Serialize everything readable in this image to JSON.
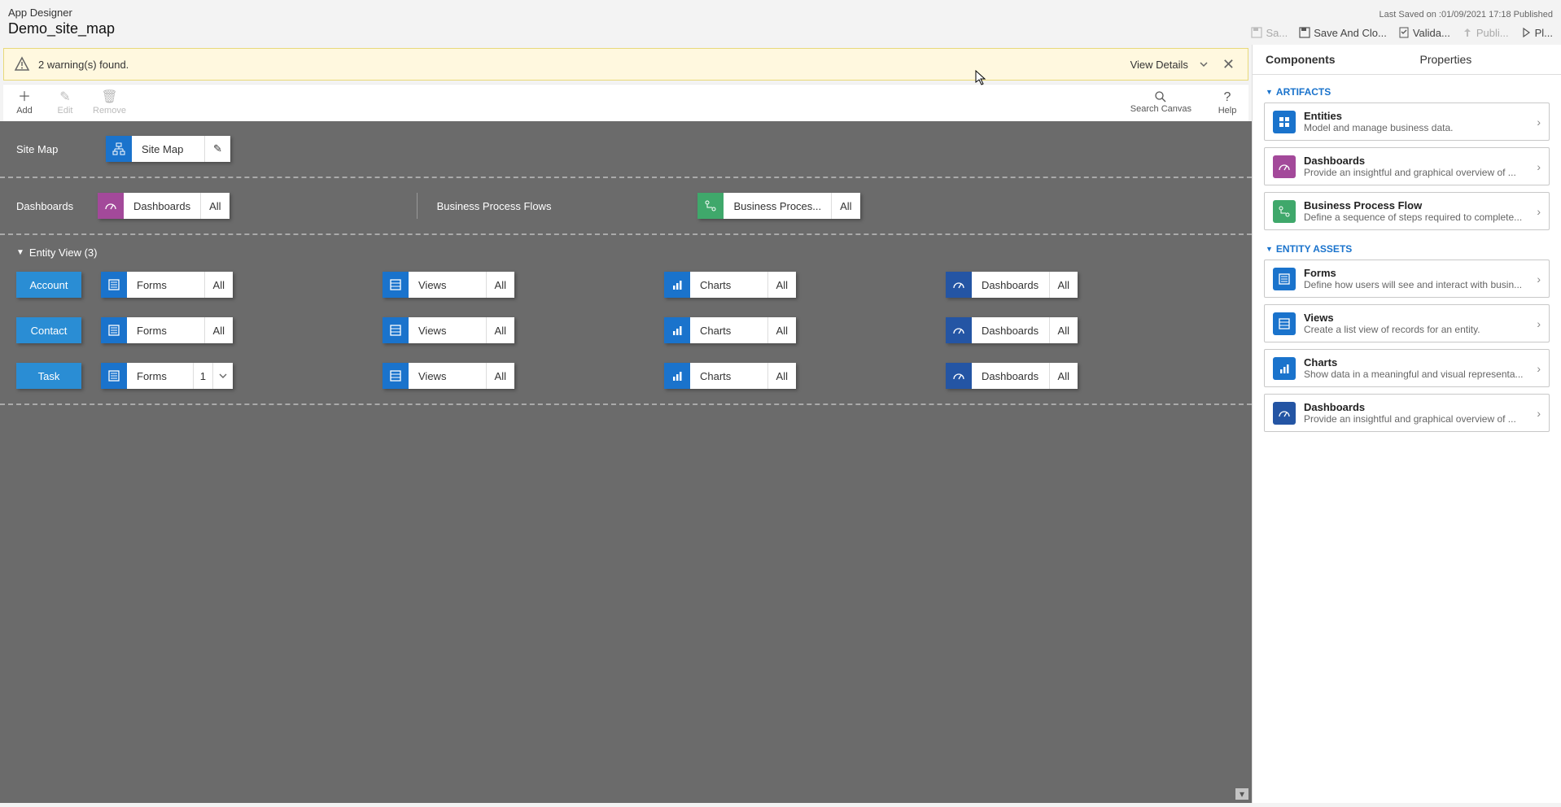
{
  "header": {
    "app_title": "App Designer",
    "app_name": "Demo_site_map",
    "last_saved": "Last Saved on :01/09/2021 17:18 Published"
  },
  "actions": {
    "save": "Sa...",
    "save_close": "Save And Clo...",
    "validate": "Valida...",
    "publish": "Publi...",
    "play": "Pl..."
  },
  "warning": {
    "text": "2 warning(s) found.",
    "view_details": "View Details"
  },
  "toolbar": {
    "add": "Add",
    "edit": "Edit",
    "remove": "Remove",
    "search": "Search Canvas",
    "help": "Help"
  },
  "canvas": {
    "sitemap_label": "Site Map",
    "sitemap_tile": "Site Map",
    "dashboards_label": "Dashboards",
    "dashboards_tile": "Dashboards",
    "dashboards_all": "All",
    "bpf_label": "Business Process Flows",
    "bpf_tile": "Business Proces...",
    "bpf_all": "All",
    "entity_view_label": "Entity View (3)",
    "entities": [
      {
        "name": "Account",
        "forms_count": "All"
      },
      {
        "name": "Contact",
        "forms_count": "All"
      },
      {
        "name": "Task",
        "forms_count": "1"
      }
    ],
    "asset_labels": {
      "forms": "Forms",
      "views": "Views",
      "charts": "Charts",
      "dashboards": "Dashboards",
      "all": "All"
    }
  },
  "panel": {
    "tab_components": "Components",
    "tab_properties": "Properties",
    "section_artifacts": "ARTIFACTS",
    "section_entity_assets": "ENTITY ASSETS",
    "artifacts": [
      {
        "title": "Entities",
        "desc": "Model and manage business data.",
        "color": "blue",
        "icon": "grid"
      },
      {
        "title": "Dashboards",
        "desc": "Provide an insightful and graphical overview of ...",
        "color": "purple",
        "icon": "gauge"
      },
      {
        "title": "Business Process Flow",
        "desc": "Define a sequence of steps required to complete...",
        "color": "green",
        "icon": "flow"
      }
    ],
    "entity_assets": [
      {
        "title": "Forms",
        "desc": "Define how users will see and interact with busin...",
        "color": "blue",
        "icon": "form"
      },
      {
        "title": "Views",
        "desc": "Create a list view of records for an entity.",
        "color": "blue",
        "icon": "list"
      },
      {
        "title": "Charts",
        "desc": "Show data in a meaningful and visual representa...",
        "color": "blue",
        "icon": "chart"
      },
      {
        "title": "Dashboards",
        "desc": "Provide an insightful and graphical overview of ...",
        "color": "navy",
        "icon": "gauge"
      }
    ]
  }
}
